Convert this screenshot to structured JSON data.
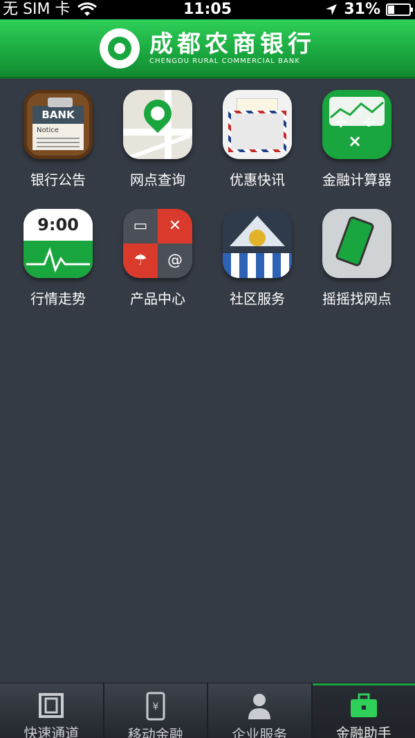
{
  "status_bar": {
    "carrier": "无 SIM 卡",
    "time": "11:05",
    "battery": "31%",
    "battery_level": 0.31
  },
  "header": {
    "bank_name_cn": "成都农商银行",
    "bank_name_en": "CHENGDU RURAL COMMERCIAL BANK"
  },
  "apps": [
    {
      "label": "银行公告",
      "icon": "bank-notice-icon",
      "icon_text": "BANK",
      "icon_subtext": "Notice"
    },
    {
      "label": "网点查询",
      "icon": "map-pin-icon"
    },
    {
      "label": "优惠快讯",
      "icon": "mail-envelope-icon"
    },
    {
      "label": "金融计算器",
      "icon": "calculator-icon",
      "icon_text": "+ ÷ ×"
    },
    {
      "label": "行情走势",
      "icon": "market-trend-icon",
      "icon_text": "9:00"
    },
    {
      "label": "产品中心",
      "icon": "product-center-icon"
    },
    {
      "label": "社区服务",
      "icon": "community-shop-icon"
    },
    {
      "label": "摇摇找网点",
      "icon": "shake-phone-icon"
    }
  ],
  "tabs": [
    {
      "label": "快速通道",
      "icon": "film-strip-icon",
      "active": false
    },
    {
      "label": "移动金融",
      "icon": "mobile-yuan-icon",
      "active": false
    },
    {
      "label": "企业服务",
      "icon": "business-person-icon",
      "active": false
    },
    {
      "label": "金融助手",
      "icon": "briefcase-icon",
      "active": true
    }
  ],
  "colors": {
    "brand_green": "#1aa63e",
    "background": "#353b45",
    "tabbar": "#2a2e35"
  }
}
